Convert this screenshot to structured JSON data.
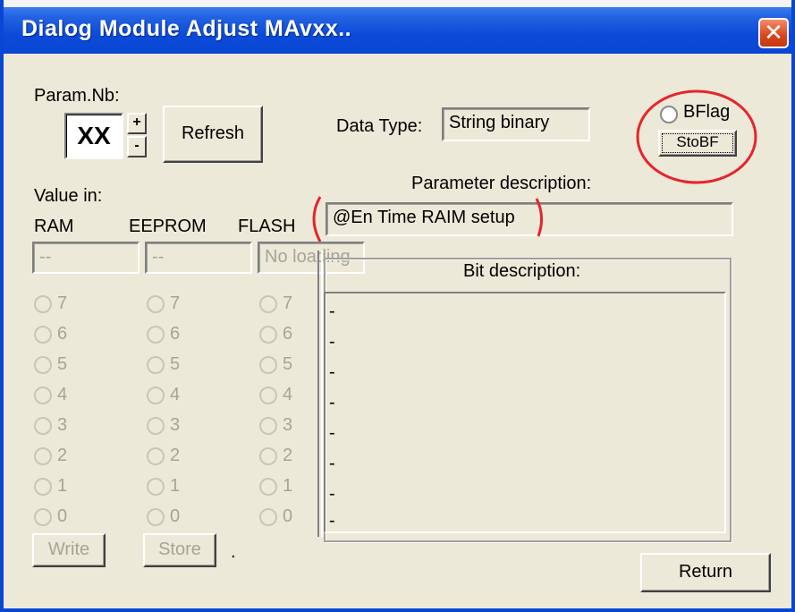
{
  "window": {
    "title": "Dialog Module Adjust MAvxx..",
    "close_glyph": "✕"
  },
  "param": {
    "label": "Param.Nb:",
    "value": "XX",
    "plus": "+",
    "minus": "-",
    "refresh_label": "Refresh"
  },
  "data_type": {
    "label": "Data Type:",
    "value": "String binary"
  },
  "bflag": {
    "label": "BFlag",
    "store_label": "StoBF"
  },
  "value_in": {
    "label": "Value in:",
    "columns": [
      "RAM",
      "EEPROM",
      "FLASH"
    ],
    "ram_field": "--",
    "eeprom_field": "--",
    "flash_field": "No loading"
  },
  "param_description": {
    "label": "Parameter description:",
    "value": "@En Time RAIM setup"
  },
  "bit_description": {
    "label": "Bit description:",
    "marks": [
      "-",
      "-",
      "-",
      "-",
      "-",
      "-",
      "-",
      "-"
    ]
  },
  "bits": [
    "7",
    "6",
    "5",
    "4",
    "3",
    "2",
    "1",
    "0"
  ],
  "buttons": {
    "write": "Write",
    "store": "Store",
    "dot": ".",
    "return": "Return"
  },
  "colors": {
    "annotation": "#e8232a",
    "title_bar": "#0a46d4"
  }
}
